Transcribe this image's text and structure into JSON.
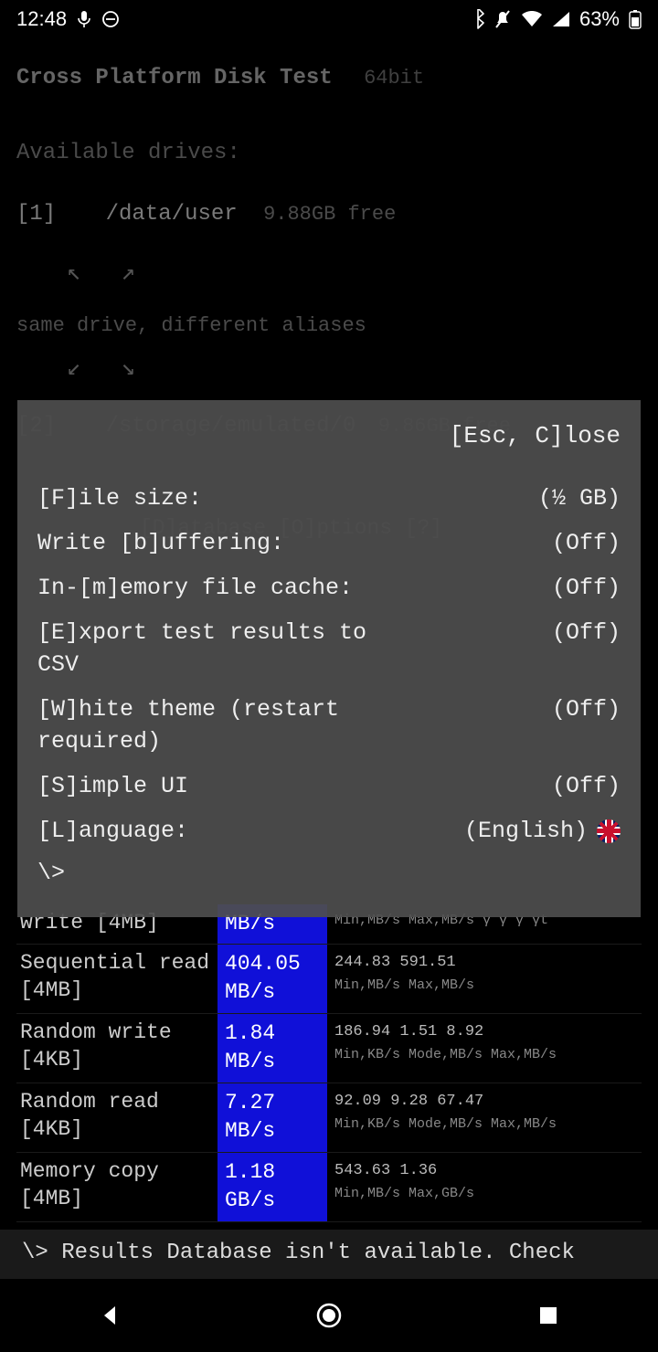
{
  "status": {
    "time": "12:48",
    "battery": "63%"
  },
  "app": {
    "title": "Cross Platform Disk Test",
    "arch": "64bit",
    "section_label": "Available drives:",
    "drive1_idx": "[1]",
    "drive1_path": "/data/user",
    "drive1_free": "9.88GB free",
    "alias_note": "same drive, different aliases",
    "drive2_idx": "[2]",
    "drive2_path": "/storage/emulated/0",
    "drive2_free": "9.86GB free",
    "menubar": "[D]atabase  [O]ptions  [?]"
  },
  "modal": {
    "close": "[Esc, C]lose",
    "options": [
      {
        "label": "[F]ile size:",
        "value": "(½ GB)"
      },
      {
        "label": "Write [b]uffering:",
        "value": "(Off)"
      },
      {
        "label": "In-[m]emory file cache:",
        "value": "(Off)"
      },
      {
        "label": "[E]xport test results to CSV",
        "value": "(Off)"
      },
      {
        "label": "[W]hite theme (restart required)",
        "value": "(Off)"
      },
      {
        "label": "[S]imple UI",
        "value": "(Off)"
      },
      {
        "label": "[L]anguage:",
        "value": "(English)"
      }
    ],
    "prompt": "\\>"
  },
  "results": {
    "row0": {
      "label": "write [4MB]",
      "value": "MB/s",
      "stats_top": "Min,MB/s Max,MB/s γ γ γ γt"
    },
    "row1": {
      "label": "Sequential read [4MB]",
      "value": "404.05 MB/s",
      "stats_top": "244.83  591.51",
      "stats_bot": "Min,MB/s Max,MB/s"
    },
    "row2": {
      "label": "Random write [4KB]",
      "value": "1.84 MB/s",
      "stats_top": "186.94  1.51   8.92",
      "stats_bot": "Min,KB/s Mode,MB/s Max,MB/s"
    },
    "row3": {
      "label": "Random read [4KB]",
      "value": "7.27 MB/s",
      "stats_top": "92.09  9.28   67.47",
      "stats_bot": "Min,KB/s Mode,MB/s Max,MB/s"
    },
    "row4": {
      "label": "Memory copy [4MB]",
      "value": "1.18 GB/s",
      "stats_top": "543.63  1.36",
      "stats_bot": "Min,MB/s Max,GB/s"
    }
  },
  "footer": "\\> Results Database isn't available. Check"
}
